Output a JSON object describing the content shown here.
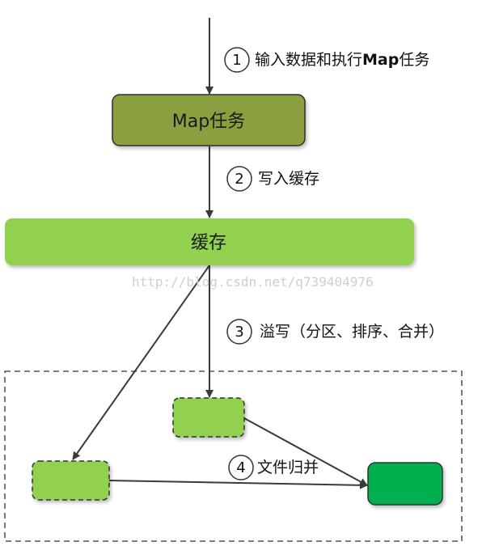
{
  "nodes": {
    "map_task": {
      "label": "Map任务",
      "fill": "#8aa040",
      "stroke": "#2e2e2e"
    },
    "buffer": {
      "label": "缓存",
      "fill": "#92d050",
      "stroke": "#92d050"
    },
    "spill_top": {
      "label": "",
      "fill": "#92d050"
    },
    "spill_left": {
      "label": "",
      "fill": "#92d050"
    },
    "merged_output": {
      "label": "",
      "fill": "#00b050"
    }
  },
  "steps": [
    {
      "number": "1",
      "text": "输入数据和执行",
      "text_bold": "Map",
      "text_after": "任务"
    },
    {
      "number": "2",
      "text": "写入缓存"
    },
    {
      "number": "3",
      "text": "溢写（分区、排序、合并）"
    },
    {
      "number": "4",
      "text": "文件归并"
    }
  ],
  "watermark": "http://blog.csdn.net/q739404976",
  "colors": {
    "line": "#3a3a3a",
    "dashed": "#333333"
  }
}
